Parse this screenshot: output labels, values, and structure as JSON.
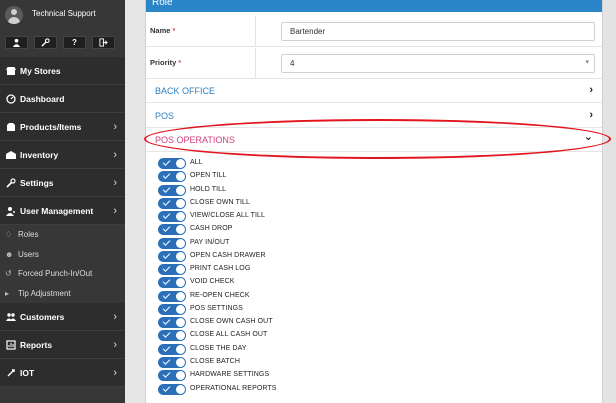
{
  "sidebar": {
    "profile_name": "Technical Support",
    "quick_buttons": [
      {
        "icon": "user-icon"
      },
      {
        "icon": "wrench-icon"
      },
      {
        "icon": "help-icon",
        "glyph": "?"
      },
      {
        "icon": "logout-icon"
      }
    ],
    "items": [
      {
        "label": "My Stores",
        "icon": "store-icon",
        "has_chevron": false
      },
      {
        "label": "Dashboard",
        "icon": "dashboard-icon",
        "has_chevron": false
      },
      {
        "label": "Products/Items",
        "icon": "products-icon",
        "has_chevron": true
      },
      {
        "label": "Inventory",
        "icon": "inventory-icon",
        "has_chevron": true
      },
      {
        "label": "Settings",
        "icon": "settings-icon",
        "has_chevron": true
      },
      {
        "label": "User Management",
        "icon": "users-icon",
        "has_chevron": true
      }
    ],
    "user_management_sub": [
      {
        "label": "Roles",
        "icon": "role-icon"
      },
      {
        "label": "Users",
        "icon": "user-icon"
      },
      {
        "label": "Forced Punch-In/Out",
        "icon": "clock-icon"
      },
      {
        "label": "Tip Adjustment",
        "icon": "tip-icon"
      }
    ],
    "items_after": [
      {
        "label": "Customers",
        "icon": "customers-icon",
        "has_chevron": true
      },
      {
        "label": "Reports",
        "icon": "reports-icon",
        "has_chevron": true
      },
      {
        "label": "IOT",
        "icon": "iot-icon",
        "has_chevron": true
      }
    ],
    "chevron_glyph": "›"
  },
  "panel": {
    "title": "Role",
    "name_label": "Name",
    "name_value": "Bartender",
    "priority_label": "Priority",
    "priority_value": "4",
    "required_marker": "*",
    "sections": [
      {
        "label": "BACK OFFICE",
        "chevron": "›",
        "active": false
      },
      {
        "label": "POS",
        "chevron": "›",
        "active": false
      },
      {
        "label": "POS OPERATIONS",
        "chevron": "⌄",
        "active": true
      }
    ],
    "permissions": [
      {
        "label": "ALL",
        "enabled": true
      },
      {
        "label": "OPEN TILL",
        "enabled": true
      },
      {
        "label": "HOLD TILL",
        "enabled": true
      },
      {
        "label": "CLOSE OWN TILL",
        "enabled": true
      },
      {
        "label": "VIEW/CLOSE ALL TILL",
        "enabled": true
      },
      {
        "label": "CASH DROP",
        "enabled": true
      },
      {
        "label": "PAY IN/OUT",
        "enabled": true
      },
      {
        "label": "OPEN CASH DRAWER",
        "enabled": true
      },
      {
        "label": "PRINT CASH LOG",
        "enabled": true
      },
      {
        "label": "VOID CHECK",
        "enabled": true
      },
      {
        "label": "RE-OPEN CHECK",
        "enabled": true
      },
      {
        "label": "POS SETTINGS",
        "enabled": true
      },
      {
        "label": "CLOSE OWN CASH OUT",
        "enabled": true
      },
      {
        "label": "CLOSE ALL CASH OUT",
        "enabled": true
      },
      {
        "label": "CLOSE THE DAY",
        "enabled": true
      },
      {
        "label": "CLOSE BATCH",
        "enabled": true
      },
      {
        "label": "HARDWARE SETTINGS",
        "enabled": true
      },
      {
        "label": "OPERATIONAL REPORTS",
        "enabled": true
      }
    ]
  },
  "colors": {
    "sidebar_bg": "#373737",
    "nav_item_bg": "#2d2d2d",
    "header_blue": "#2a86c8",
    "section_blue": "#2d7fbf",
    "active_pink": "#d0407a",
    "toggle_blue": "#2a6fb7",
    "annotation_red": "#e3161f"
  }
}
